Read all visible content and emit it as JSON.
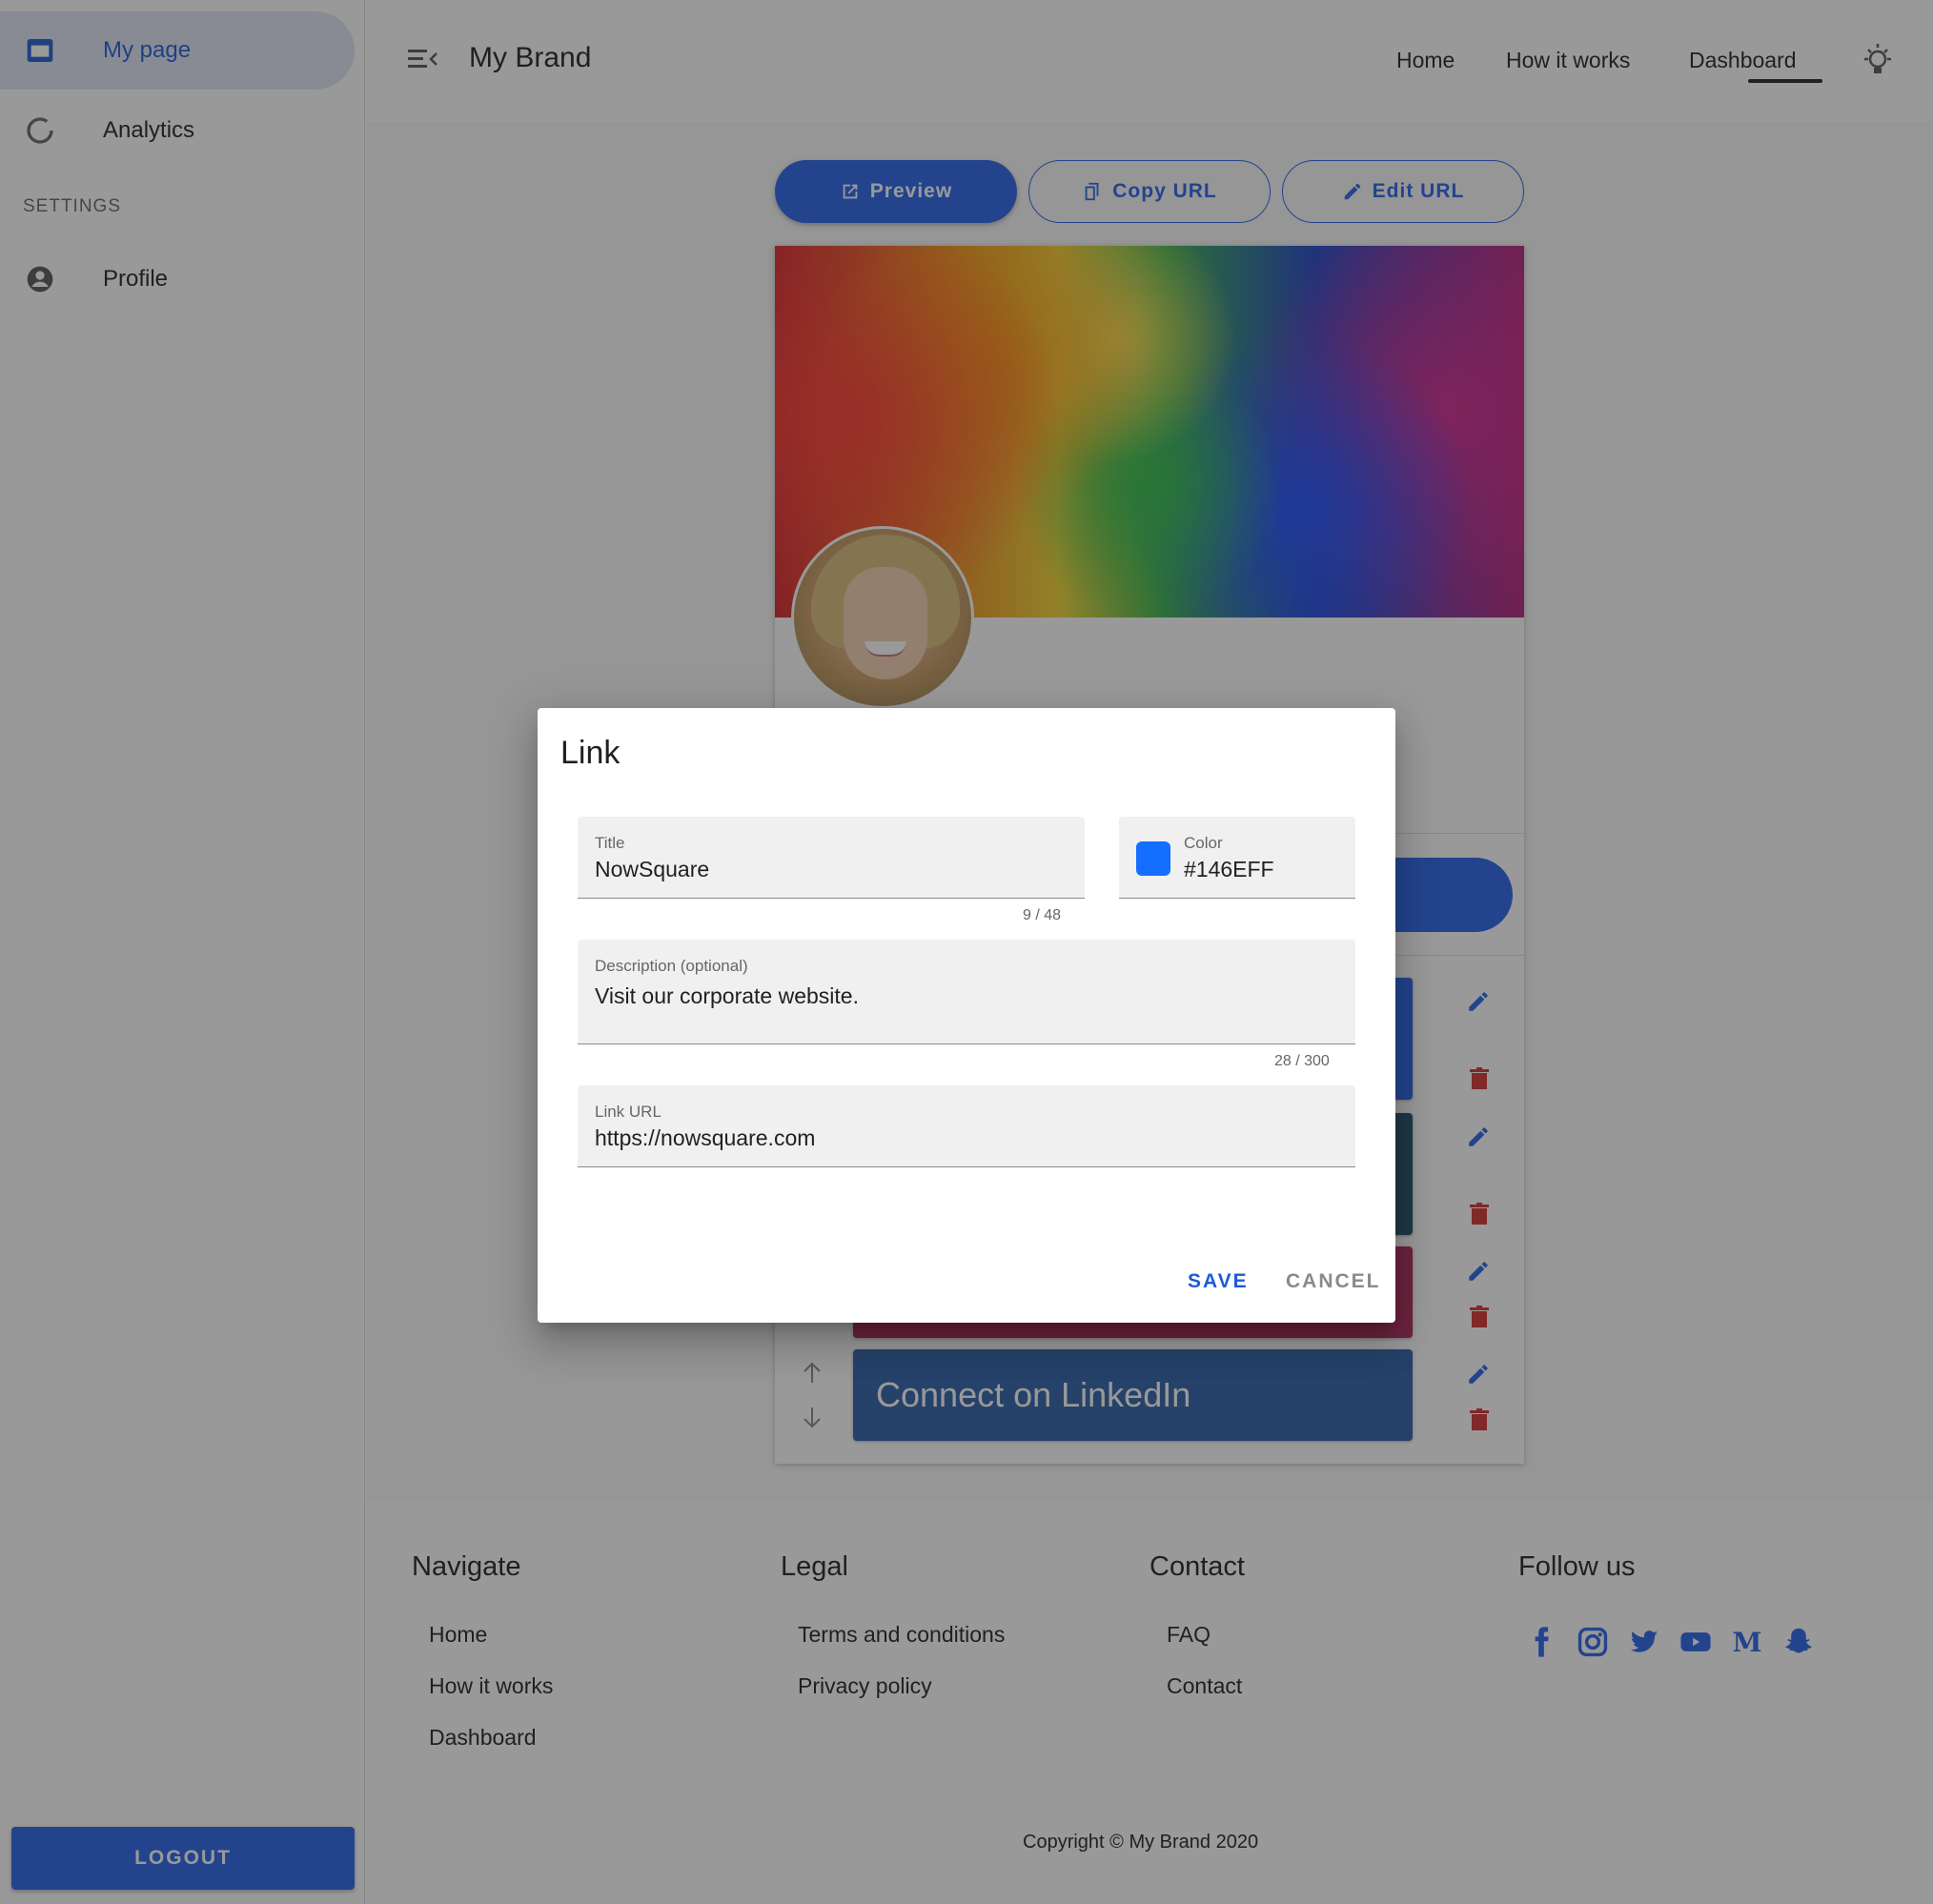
{
  "sidebar": {
    "items": [
      {
        "label": "My page",
        "icon": "web-page-icon"
      },
      {
        "label": "Analytics",
        "icon": "donut-chart-icon"
      }
    ],
    "settings_header": "SETTINGS",
    "settings_items": [
      {
        "label": "Profile",
        "icon": "account-circle-icon"
      }
    ],
    "logout_label": "LOGOUT"
  },
  "topbar": {
    "brand": "My Brand",
    "links": [
      "Home",
      "How it works",
      "Dashboard"
    ],
    "active_link": "Dashboard"
  },
  "actions": {
    "preview": "Preview",
    "copy_url": "Copy URL",
    "edit_url": "Edit URL"
  },
  "page_card": {
    "link_blocks": [
      {
        "label": "",
        "color": "#2562e9"
      },
      {
        "label": "",
        "color": "#1f4f6a"
      },
      {
        "label": "",
        "color": "#b0265a"
      },
      {
        "label": "Connect on LinkedIn",
        "color": "#2c5fa8"
      }
    ]
  },
  "dialog": {
    "title": "Link",
    "title_field": {
      "label": "Title",
      "value": "NowSquare",
      "counter": "9 / 48"
    },
    "color_field": {
      "label": "Color",
      "value": "#146EFF"
    },
    "description_field": {
      "label": "Description (optional)",
      "value": "Visit our corporate website.",
      "counter": "28 / 300"
    },
    "url_field": {
      "label": "Link URL",
      "value": "https://nowsquare.com"
    },
    "save": "SAVE",
    "cancel": "CANCEL"
  },
  "footer": {
    "navigate": {
      "heading": "Navigate",
      "links": [
        "Home",
        "How it works",
        "Dashboard"
      ]
    },
    "legal": {
      "heading": "Legal",
      "links": [
        "Terms and conditions",
        "Privacy policy"
      ]
    },
    "contact": {
      "heading": "Contact",
      "links": [
        "FAQ",
        "Contact"
      ]
    },
    "follow": {
      "heading": "Follow us",
      "icons": [
        "facebook-icon",
        "instagram-icon",
        "twitter-icon",
        "youtube-icon",
        "medium-icon",
        "snapchat-icon"
      ]
    },
    "copyright": "Copyright © My Brand 2020"
  },
  "colors": {
    "accent": "#2562e9",
    "delete": "#d32f2f"
  }
}
